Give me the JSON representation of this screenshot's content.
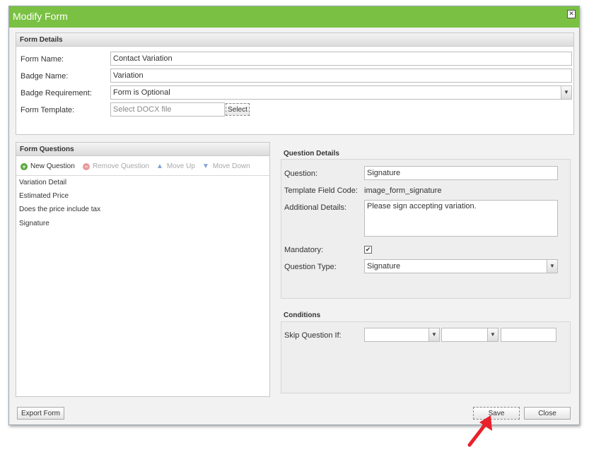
{
  "dialog": {
    "title": "Modify Form",
    "close_symbol": "✕"
  },
  "form_details": {
    "header": "Form Details",
    "form_name_label": "Form Name:",
    "form_name_value": "Contact Variation",
    "badge_name_label": "Badge Name:",
    "badge_name_value": "Variation",
    "badge_requirement_label": "Badge Requirement:",
    "badge_requirement_value": "Form is Optional",
    "form_template_label": "Form Template:",
    "form_template_placeholder": "Select DOCX file",
    "select_button": "Select"
  },
  "form_questions": {
    "header": "Form Questions",
    "toolbar": {
      "new_question": "New Question",
      "remove_question": "Remove Question",
      "move_up": "Move Up",
      "move_down": "Move Down"
    },
    "items": [
      "Variation Detail",
      "Estimated Price",
      "Does the price include tax",
      "Signature"
    ]
  },
  "question_details": {
    "header": "Question Details",
    "question_label": "Question:",
    "question_value": "Signature",
    "template_field_code_label": "Template Field Code:",
    "template_field_code_value": "image_form_signature",
    "additional_details_label": "Additional Details:",
    "additional_details_value": "Please sign accepting variation.",
    "mandatory_label": "Mandatory:",
    "mandatory_checked": true,
    "mandatory_check": "✔",
    "question_type_label": "Question Type:",
    "question_type_value": "Signature"
  },
  "conditions": {
    "header": "Conditions",
    "skip_question_if_label": "Skip Question If:",
    "condition_field_value": "",
    "condition_operator_value": "",
    "condition_value": ""
  },
  "footer": {
    "export_form": "Export Form",
    "save": "Save",
    "close": "Close"
  },
  "colors": {
    "title_bar": "#7ac143",
    "arrow": "#e8212a"
  },
  "icons": {
    "new_question": "plus-circle-icon",
    "remove_question": "minus-circle-icon",
    "move_up": "arrow-up-icon",
    "move_down": "arrow-down-icon",
    "dropdown": "chevron-down-icon",
    "pointer": "red-arrow-icon"
  }
}
